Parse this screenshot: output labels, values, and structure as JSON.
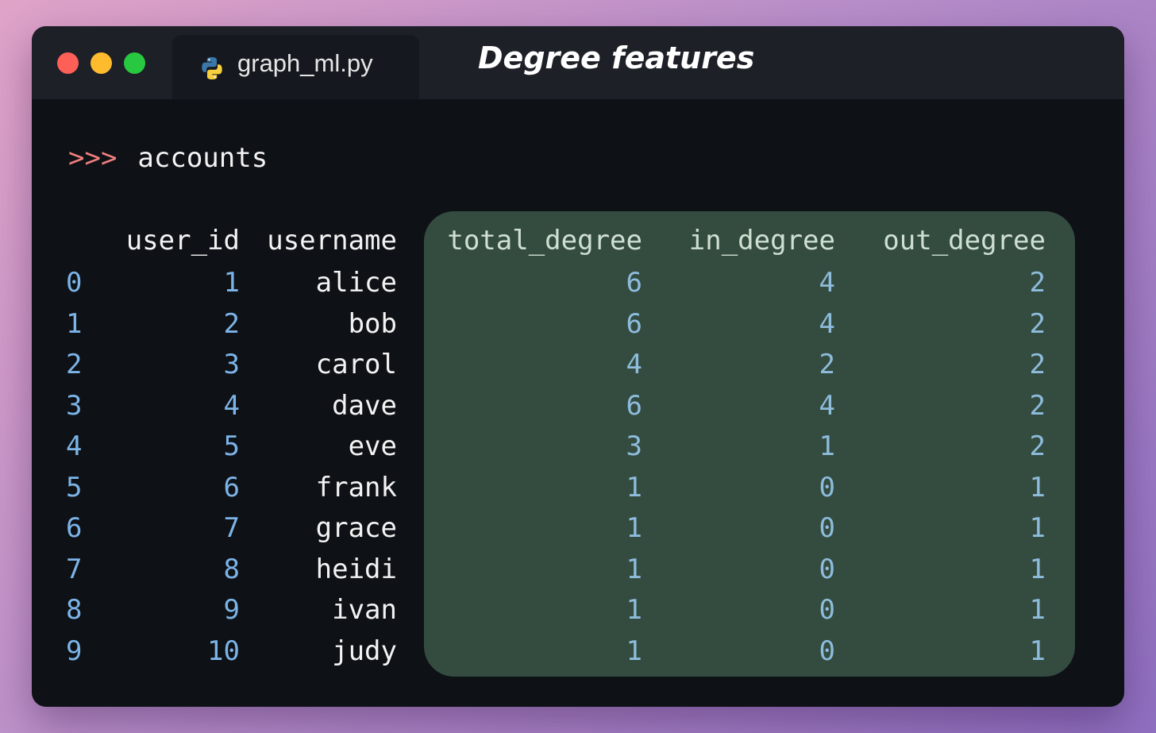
{
  "window": {
    "tab_label": "graph_ml.py",
    "title": "Degree features",
    "controls": {
      "close_color": "#fe5f57",
      "minimize_color": "#febb2e",
      "maximize_color": "#28c840"
    }
  },
  "terminal": {
    "prompt": ">>>",
    "command": "accounts"
  },
  "table": {
    "columns": [
      "user_id",
      "username",
      "total_degree",
      "in_degree",
      "out_degree"
    ],
    "highlighted_columns": [
      "total_degree",
      "in_degree",
      "out_degree"
    ],
    "highlight_color": "#344c40",
    "rows": [
      {
        "index": "0",
        "user_id": "1",
        "username": "alice",
        "total_degree": "6",
        "in_degree": "4",
        "out_degree": "2"
      },
      {
        "index": "1",
        "user_id": "2",
        "username": "bob",
        "total_degree": "6",
        "in_degree": "4",
        "out_degree": "2"
      },
      {
        "index": "2",
        "user_id": "3",
        "username": "carol",
        "total_degree": "4",
        "in_degree": "2",
        "out_degree": "2"
      },
      {
        "index": "3",
        "user_id": "4",
        "username": "dave",
        "total_degree": "6",
        "in_degree": "4",
        "out_degree": "2"
      },
      {
        "index": "4",
        "user_id": "5",
        "username": "eve",
        "total_degree": "3",
        "in_degree": "1",
        "out_degree": "2"
      },
      {
        "index": "5",
        "user_id": "6",
        "username": "frank",
        "total_degree": "1",
        "in_degree": "0",
        "out_degree": "1"
      },
      {
        "index": "6",
        "user_id": "7",
        "username": "grace",
        "total_degree": "1",
        "in_degree": "0",
        "out_degree": "1"
      },
      {
        "index": "7",
        "user_id": "8",
        "username": "heidi",
        "total_degree": "1",
        "in_degree": "0",
        "out_degree": "1"
      },
      {
        "index": "8",
        "user_id": "9",
        "username": "ivan",
        "total_degree": "1",
        "in_degree": "0",
        "out_degree": "1"
      },
      {
        "index": "9",
        "user_id": "10",
        "username": "judy",
        "total_degree": "1",
        "in_degree": "0",
        "out_degree": "1"
      }
    ]
  },
  "icons": {
    "tab_icon": "python-icon"
  }
}
